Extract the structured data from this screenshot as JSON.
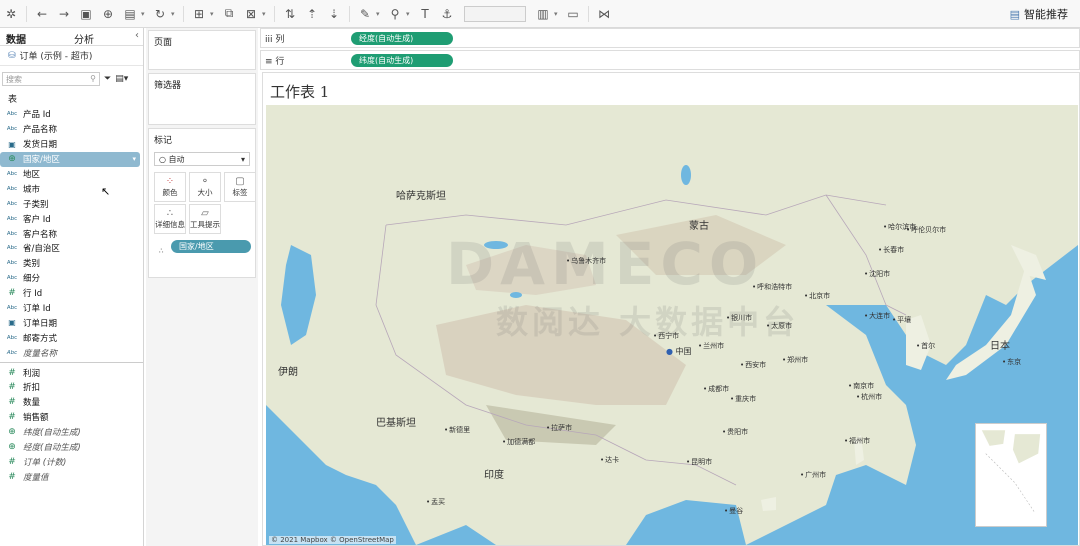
{
  "toolbar": {
    "smart_label": "智能推荐"
  },
  "leftpane": {
    "tab_data": "数据",
    "tab_analysis": "分析",
    "datasource": "订单 (示例 - 超市)",
    "search_placeholder": "搜索",
    "section_tables": "表",
    "dimensions": [
      {
        "type": "Abc",
        "name": "产品 Id"
      },
      {
        "type": "Abc",
        "name": "产品名称"
      },
      {
        "type": "date",
        "name": "发货日期"
      },
      {
        "type": "geo",
        "name": "国家/地区"
      },
      {
        "type": "Abc",
        "name": "地区"
      },
      {
        "type": "Abc",
        "name": "城市"
      },
      {
        "type": "Abc",
        "name": "子类别"
      },
      {
        "type": "Abc",
        "name": "客户 Id"
      },
      {
        "type": "Abc",
        "name": "客户名称"
      },
      {
        "type": "Abc",
        "name": "省/自治区"
      },
      {
        "type": "Abc",
        "name": "类别"
      },
      {
        "type": "Abc",
        "name": "细分"
      },
      {
        "type": "#",
        "name": "行 Id"
      },
      {
        "type": "Abc",
        "name": "订单 Id"
      },
      {
        "type": "date",
        "name": "订单日期"
      },
      {
        "type": "Abc",
        "name": "邮寄方式"
      },
      {
        "type": "Abc",
        "name": "度量名称"
      }
    ],
    "measures": [
      {
        "type": "#",
        "name": "利润"
      },
      {
        "type": "#",
        "name": "折扣"
      },
      {
        "type": "#",
        "name": "数量"
      },
      {
        "type": "#",
        "name": "销售额"
      },
      {
        "type": "geo",
        "name": "纬度(自动生成)"
      },
      {
        "type": "geo",
        "name": "经度(自动生成)"
      },
      {
        "type": "#",
        "name": "订单 (计数)"
      },
      {
        "type": "#",
        "name": "度量值"
      }
    ]
  },
  "midpane": {
    "pages": "页面",
    "filters": "筛选器",
    "marks": "标记",
    "mark_type": "自动",
    "buttons": [
      "颜色",
      "大小",
      "标签",
      "详细信息",
      "工具提示"
    ],
    "mark_pill": "国家/地区"
  },
  "shelves": {
    "columns_label": "列",
    "rows_label": "行",
    "columns_pill": "经度(自动生成)",
    "rows_pill": "纬度(自动生成)"
  },
  "view": {
    "title": "工作表 1",
    "attribution": "© 2021 Mapbox © OpenStreetMap",
    "watermark": "DAMECO",
    "watermark_cn": "数阅达 大数据中台"
  },
  "map_labels": {
    "regions": [
      "哈萨克斯坦",
      "蒙古",
      "伊朗",
      "巴基斯坦",
      "印度",
      "日本",
      "中国"
    ],
    "cities": [
      "乌鲁木齐市",
      "呼伦贝尔市",
      "长春市",
      "沈阳市",
      "哈尔滨市",
      "北京市",
      "呼和浩特市",
      "兰州市",
      "西安市",
      "郑州市",
      "南京市",
      "成都市",
      "重庆市",
      "贵阳市",
      "昆明市",
      "广州市",
      "杭州市",
      "福州市",
      "拉萨市",
      "加德满都",
      "新德里",
      "孟买",
      "达卡",
      "曼谷",
      "首尔",
      "东京",
      "平壤",
      "大连市",
      "西宁市",
      "银川市",
      "太原市"
    ]
  }
}
